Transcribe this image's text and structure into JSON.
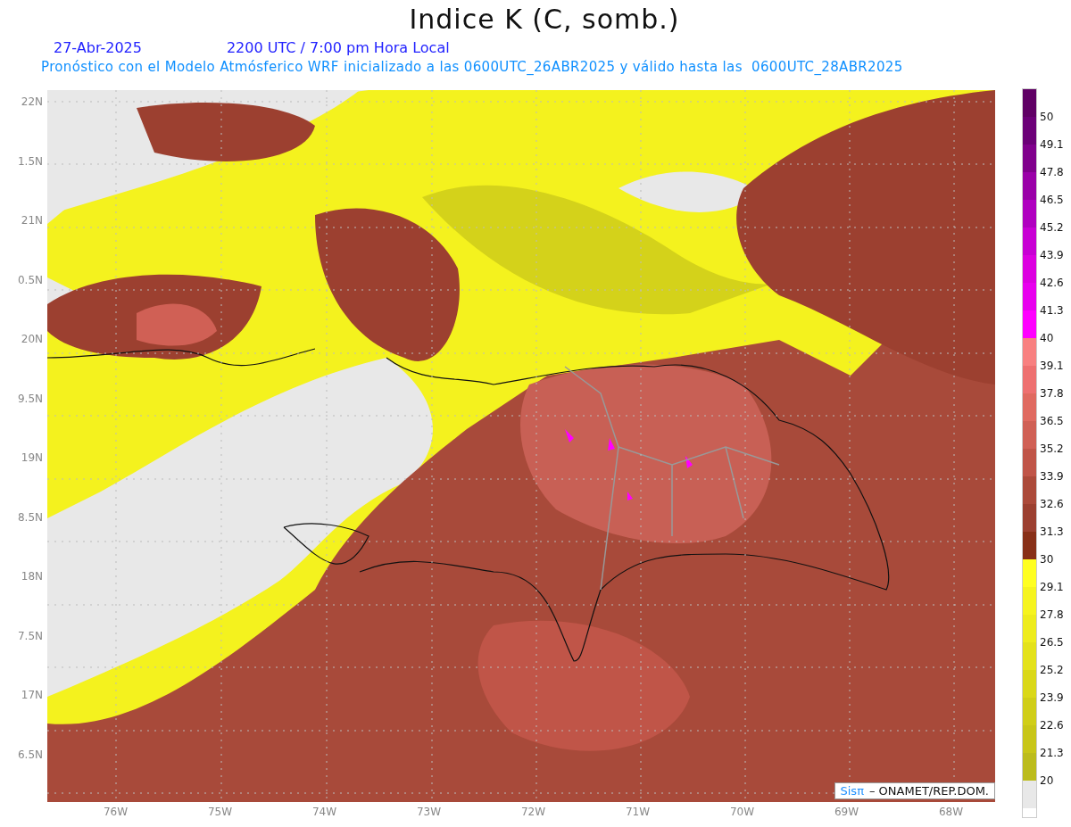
{
  "title": "Indice K (C, somb.)",
  "date": "27-Abr-2025",
  "time": "2200 UTC / 7:00 pm Hora Local",
  "subtitle": "Pronóstico con el Modelo Atmósferico WRF inicializado a las 0600UTC_26ABR2025 y válido hasta las  0600UTC_28ABR2025",
  "lat_labels": [
    "22N",
    "1.5N",
    "21N",
    "0.5N",
    "20N",
    "9.5N",
    "19N",
    "8.5N",
    "18N",
    "7.5N",
    "17N",
    "6.5N"
  ],
  "lon_labels": [
    "76W",
    "75W",
    "74W",
    "73W",
    "72W",
    "71W",
    "70W",
    "69W",
    "68W"
  ],
  "colorbar": [
    {
      "color": "#600065",
      "label": "50"
    },
    {
      "color": "#6c0078",
      "label": "49.1"
    },
    {
      "color": "#80008c",
      "label": "47.8"
    },
    {
      "color": "#9a00a8",
      "label": "46.5"
    },
    {
      "color": "#b000c0",
      "label": "45.2"
    },
    {
      "color": "#c800d4",
      "label": "43.9"
    },
    {
      "color": "#dc00e0",
      "label": "42.6"
    },
    {
      "color": "#e800ee",
      "label": "41.3"
    },
    {
      "color": "#ff00ff",
      "label": "40"
    },
    {
      "color": "#f88080",
      "label": "39.1"
    },
    {
      "color": "#ee7070",
      "label": "37.8"
    },
    {
      "color": "#e06a60",
      "label": "36.5"
    },
    {
      "color": "#d06055",
      "label": "35.2"
    },
    {
      "color": "#c05548",
      "label": "33.9"
    },
    {
      "color": "#ac4a3a",
      "label": "32.6"
    },
    {
      "color": "#9c4030",
      "label": "31.3"
    },
    {
      "color": "#883018",
      "label": "30"
    },
    {
      "color": "#ffff20",
      "label": "29.1"
    },
    {
      "color": "#f6f41e",
      "label": "27.8"
    },
    {
      "color": "#eeec1c",
      "label": "26.5"
    },
    {
      "color": "#e4e21a",
      "label": "25.2"
    },
    {
      "color": "#dad818",
      "label": "23.9"
    },
    {
      "color": "#d0ce18",
      "label": "22.6"
    },
    {
      "color": "#c8c618",
      "label": "21.3"
    },
    {
      "color": "#bcbc1c",
      "label": "20"
    },
    {
      "color": "#e8e8e8"
    }
  ],
  "credit": {
    "logo": "Sisπ",
    "text": "– ONAMET/REP.DOM."
  }
}
